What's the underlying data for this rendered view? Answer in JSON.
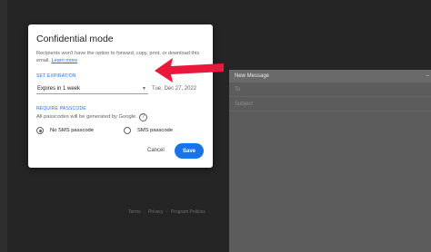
{
  "dialog": {
    "title": "Confidential mode",
    "description": "Recipients won't have the option to forward, copy, print, or download this email.",
    "learn_more": "Learn more",
    "set_expiration_label": "SET EXPIRATION",
    "expiry_option": "Expires in 1 week",
    "expiry_date": "Tue, Dec 27, 2022",
    "require_passcode_label": "REQUIRE PASSCODE",
    "passcode_note": "All passcodes will be generated by Google.",
    "help_glyph": "?",
    "no_sms_label": "No SMS passcode",
    "sms_label": "SMS passcode",
    "cancel_label": "Cancel",
    "save_label": "Save"
  },
  "compose": {
    "header_title": "New Message",
    "header_btn": "–",
    "to_label": "To",
    "subject_label": "Subject"
  },
  "footer": {
    "terms": "Terms",
    "sep1": "·",
    "privacy": "Privacy",
    "sep2": "·",
    "program_policies": "Program Policies"
  },
  "colors": {
    "accent": "#1a73e8",
    "arrow": "#e8193c",
    "overlay": "#252526"
  },
  "icons": {
    "help": "help-circle-icon",
    "dropdown": "chevron-down-icon",
    "pointer": "red-arrow-annotation"
  },
  "state": {
    "selected_radio": "no_sms"
  }
}
